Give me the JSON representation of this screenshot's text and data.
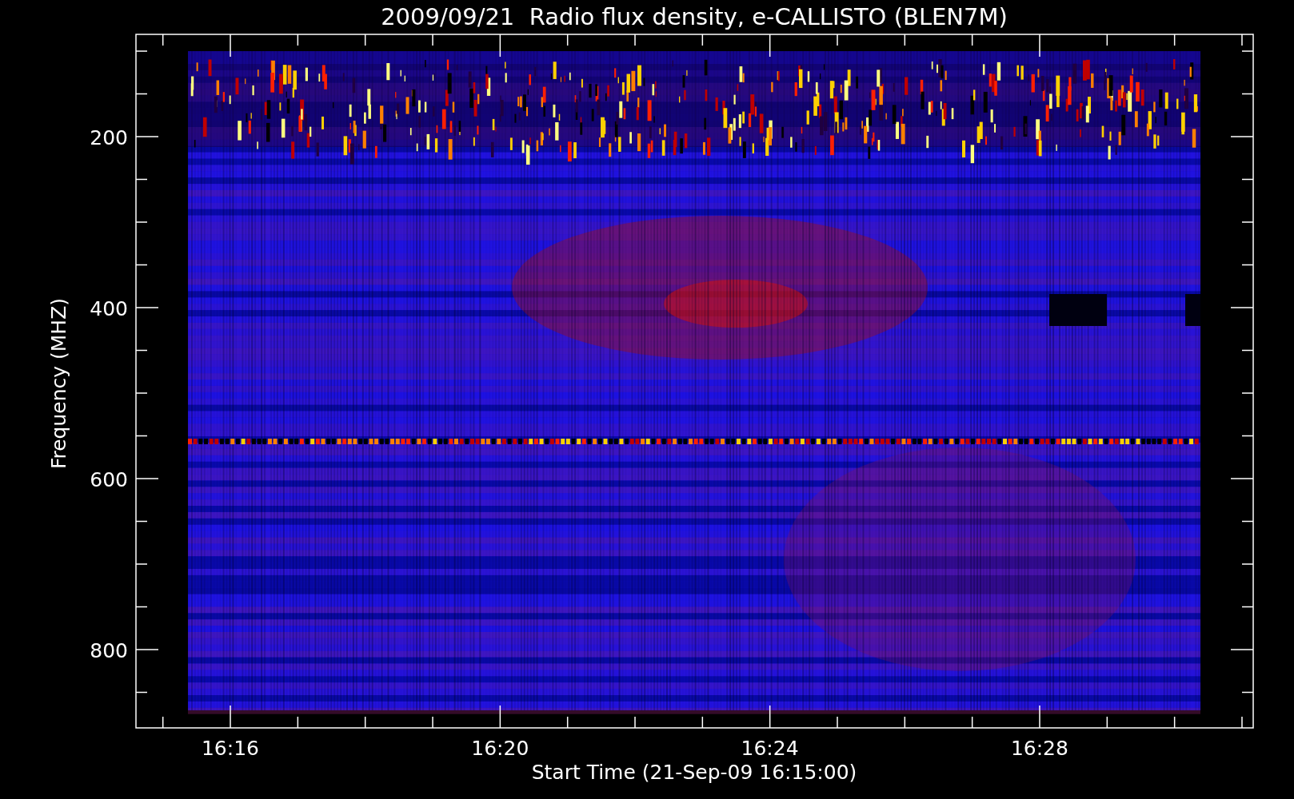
{
  "title": "2009/09/21  Radio flux density, e-CALLISTO (BLEN7M)",
  "y_axis": {
    "label": "Frequency (MHZ)",
    "ticks": [
      "200",
      "400",
      "600",
      "800"
    ]
  },
  "x_axis": {
    "label": "Start Time (21-Sep-09 16:15:00)",
    "ticks": [
      "16:16",
      "16:20",
      "16:24",
      "16:28"
    ]
  }
}
